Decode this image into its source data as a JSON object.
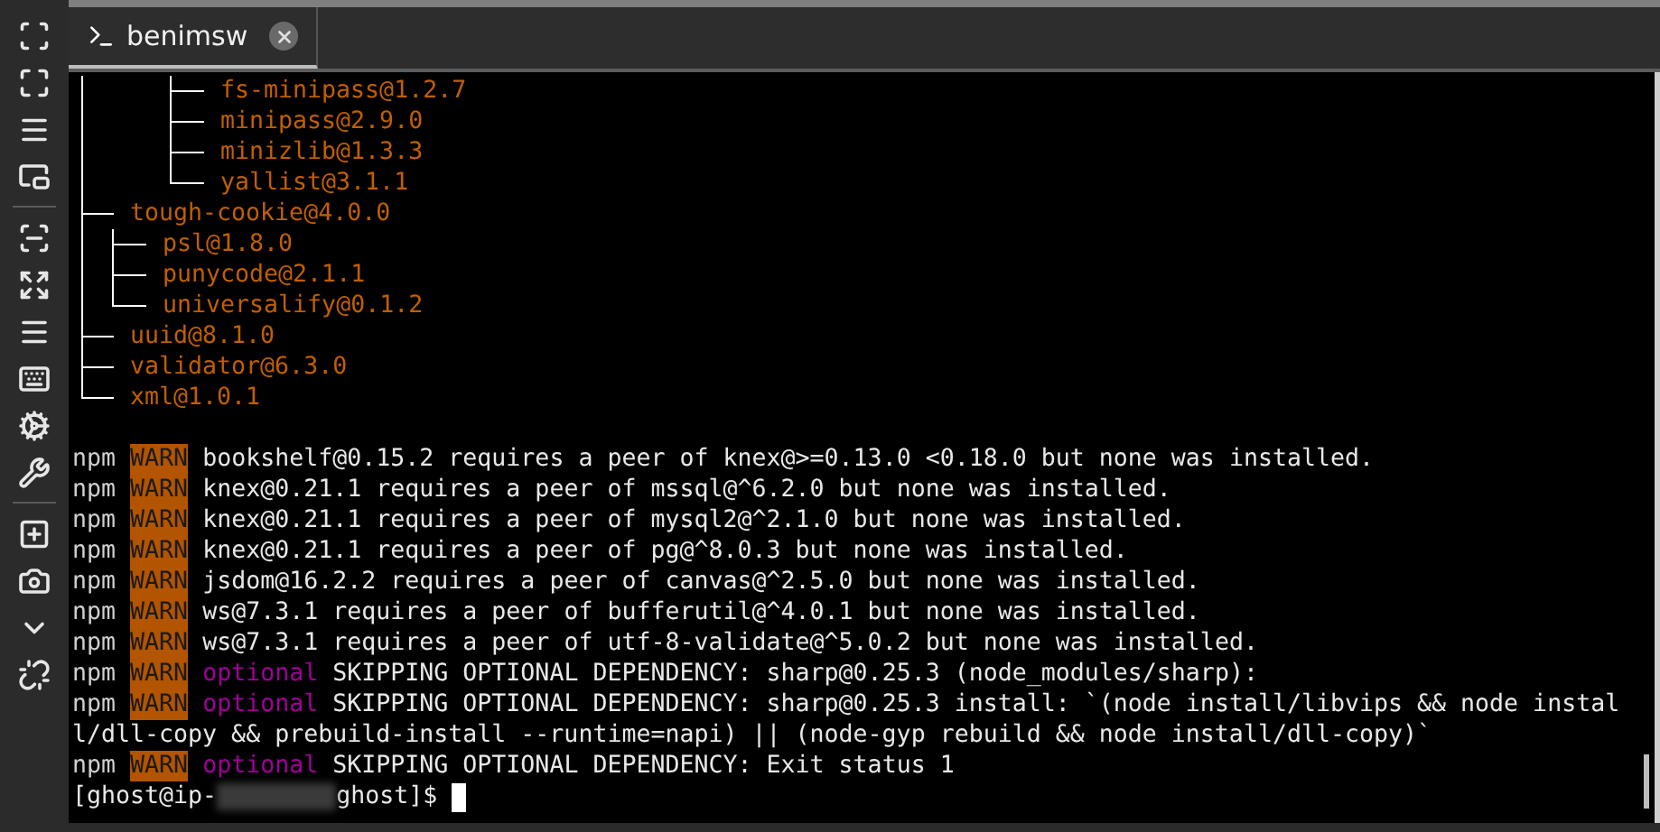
{
  "tab": {
    "label": "benimsw",
    "selected": true
  },
  "tree": [
    {
      "children": [
        {
          "label": "fs-minipass@1.2.7"
        },
        {
          "label": "minipass@2.9.0"
        },
        {
          "label": "minizlib@1.3.3"
        },
        {
          "label": "yallist@3.1.1"
        }
      ]
    },
    {
      "label": "tough-cookie@4.0.0",
      "children": [
        {
          "label": "psl@1.8.0"
        },
        {
          "label": "punycode@2.1.1"
        },
        {
          "label": "universalify@0.1.2"
        }
      ]
    },
    {
      "label": "uuid@8.1.0"
    },
    {
      "label": "validator@6.3.0"
    },
    {
      "label": "xml@1.0.1"
    }
  ],
  "log": [
    {
      "kind": "warn",
      "prefix": "npm",
      "level": "WARN",
      "message": "bookshelf@0.15.2 requires a peer of knex@>=0.13.0 <0.18.0 but none was installed."
    },
    {
      "kind": "warn",
      "prefix": "npm",
      "level": "WARN",
      "message": "knex@0.21.1 requires a peer of mssql@^6.2.0 but none was installed."
    },
    {
      "kind": "warn",
      "prefix": "npm",
      "level": "WARN",
      "message": "knex@0.21.1 requires a peer of mysql2@^2.1.0 but none was installed."
    },
    {
      "kind": "warn",
      "prefix": "npm",
      "level": "WARN",
      "message": "knex@0.21.1 requires a peer of pg@^8.0.3 but none was installed."
    },
    {
      "kind": "warn",
      "prefix": "npm",
      "level": "WARN",
      "message": "jsdom@16.2.2 requires a peer of canvas@^2.5.0 but none was installed."
    },
    {
      "kind": "warn",
      "prefix": "npm",
      "level": "WARN",
      "message": "ws@7.3.1 requires a peer of bufferutil@^4.0.1 but none was installed."
    },
    {
      "kind": "warn",
      "prefix": "npm",
      "level": "WARN",
      "message": "ws@7.3.1 requires a peer of utf-8-validate@^5.0.2 but none was installed."
    },
    {
      "kind": "optional",
      "prefix": "npm",
      "level": "WARN",
      "tag": "optional",
      "message": "SKIPPING OPTIONAL DEPENDENCY: sharp@0.25.3 (node_modules/sharp):"
    },
    {
      "kind": "optional",
      "prefix": "npm",
      "level": "WARN",
      "tag": "optional",
      "message": "SKIPPING OPTIONAL DEPENDENCY: sharp@0.25.3 install: `(node install/libvips && node instal"
    },
    {
      "kind": "plain",
      "message": "l/dll-copy && prebuild-install --runtime=napi) || (node-gyp rebuild && node install/dll-copy)`"
    },
    {
      "kind": "optional",
      "prefix": "npm",
      "level": "WARN",
      "tag": "optional",
      "message": "SKIPPING OPTIONAL DEPENDENCY: Exit status 1"
    }
  ],
  "prompt": {
    "before": "[ghost@ip-",
    "after": "ghost]$"
  }
}
